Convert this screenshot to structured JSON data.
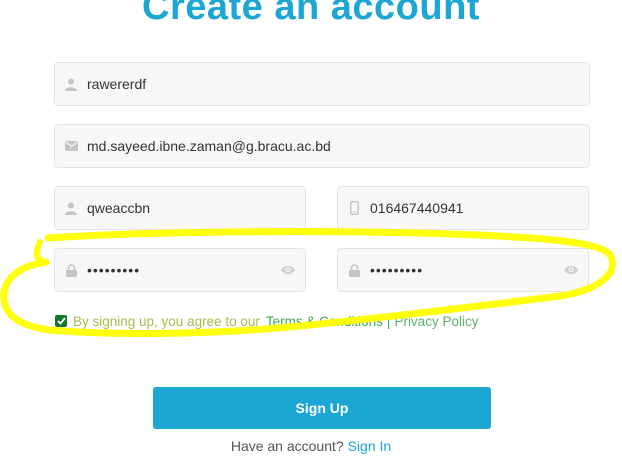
{
  "page": {
    "title": "Create an account"
  },
  "form": {
    "name": {
      "value": "rawererdf",
      "icon": "user-icon"
    },
    "email": {
      "value": "md.sayeed.ibne.zaman@g.bracu.ac.bd",
      "icon": "envelope-icon"
    },
    "username": {
      "value": "qweaccbn",
      "icon": "user-icon"
    },
    "phone": {
      "value": "016467440941",
      "icon": "phone-icon"
    },
    "password": {
      "value": "•••••••••",
      "icon": "lock-icon",
      "toggle_icon": "eye-icon"
    },
    "confirm_password": {
      "value": "•••••••••",
      "icon": "lock-icon",
      "toggle_icon": "eye-icon"
    }
  },
  "terms": {
    "checked": true,
    "text": "By signing up, you agree to our",
    "terms_link": "Terms & Conditions",
    "separator": "|",
    "privacy_link": "Privacy Policy"
  },
  "signup_button": "Sign Up",
  "footer": {
    "text": "Have an account?",
    "signin_link": "Sign In"
  },
  "colors": {
    "accent": "#1ba6d3",
    "highlight": "#ffff00",
    "checkbox": "#0f7a2b"
  }
}
